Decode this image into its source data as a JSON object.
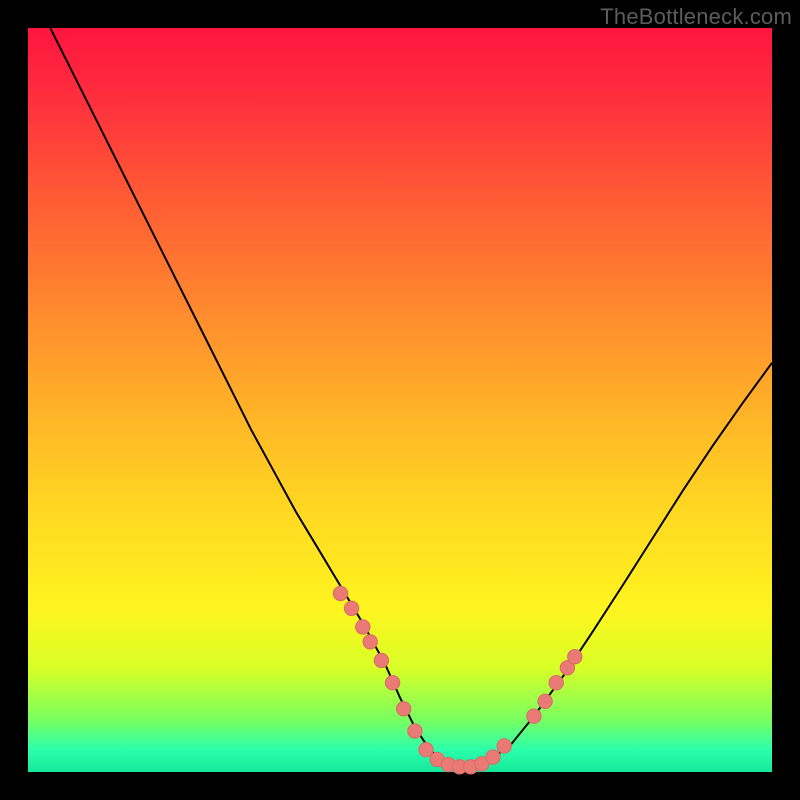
{
  "watermark": "TheBottleneck.com",
  "colors": {
    "dot": "#e97a75",
    "curve": "#000000"
  },
  "chart_data": {
    "type": "line",
    "title": "",
    "xlabel": "",
    "ylabel": "",
    "xlim": [
      0,
      100
    ],
    "ylim": [
      0,
      100
    ],
    "series": [
      {
        "name": "curve",
        "x": [
          3,
          6,
          9,
          12,
          15,
          18,
          21,
          24,
          27,
          30,
          33,
          36,
          39,
          42,
          45,
          48,
          50,
          52,
          54,
          56,
          58,
          60,
          62,
          65,
          68,
          72,
          76,
          80,
          84,
          88,
          92,
          96,
          100
        ],
        "y": [
          100,
          94,
          88,
          82,
          76,
          70,
          64,
          58,
          52,
          46,
          40.5,
          35,
          30,
          25,
          20,
          14.5,
          10,
          6,
          3,
          1.3,
          0.6,
          0.6,
          1.5,
          3.8,
          7.5,
          13,
          19,
          25.2,
          31.5,
          37.8,
          43.8,
          49.5,
          55
        ]
      }
    ],
    "markers": [
      {
        "x": 42.0,
        "y": 24.0
      },
      {
        "x": 43.5,
        "y": 22.0
      },
      {
        "x": 45.0,
        "y": 19.5
      },
      {
        "x": 46.0,
        "y": 17.5
      },
      {
        "x": 47.5,
        "y": 15.0
      },
      {
        "x": 49.0,
        "y": 12.0
      },
      {
        "x": 50.5,
        "y": 8.5
      },
      {
        "x": 52.0,
        "y": 5.5
      },
      {
        "x": 53.5,
        "y": 3.0
      },
      {
        "x": 55.0,
        "y": 1.7
      },
      {
        "x": 56.5,
        "y": 1.0
      },
      {
        "x": 58.0,
        "y": 0.7
      },
      {
        "x": 59.5,
        "y": 0.7
      },
      {
        "x": 61.0,
        "y": 1.1
      },
      {
        "x": 62.5,
        "y": 2.0
      },
      {
        "x": 64.0,
        "y": 3.5
      },
      {
        "x": 68.0,
        "y": 7.5
      },
      {
        "x": 69.5,
        "y": 9.5
      },
      {
        "x": 71.0,
        "y": 12.0
      },
      {
        "x": 72.5,
        "y": 14.0
      },
      {
        "x": 73.5,
        "y": 15.5
      }
    ]
  }
}
